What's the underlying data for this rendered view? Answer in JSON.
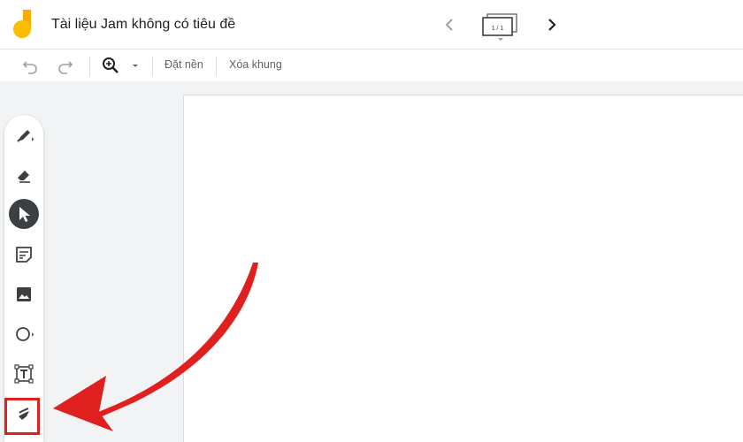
{
  "header": {
    "title": "Tài liệu Jam không có tiêu đề",
    "frame_counter": "1 / 1"
  },
  "toolbar": {
    "undo_icon": "undo-icon",
    "redo_icon": "redo-icon",
    "zoom_icon": "zoom-in-icon",
    "set_background_label": "Đặt nền",
    "clear_frame_label": "Xóa khung"
  },
  "tools": [
    {
      "name": "pen-tool",
      "icon": "pen-icon"
    },
    {
      "name": "eraser-tool",
      "icon": "eraser-icon"
    },
    {
      "name": "select-tool",
      "icon": "cursor-arrow-icon",
      "selected": true
    },
    {
      "name": "sticky-note-tool",
      "icon": "sticky-note-icon"
    },
    {
      "name": "image-tool",
      "icon": "image-icon"
    },
    {
      "name": "shape-tool",
      "icon": "circle-icon"
    },
    {
      "name": "text-box-tool",
      "icon": "text-box-icon"
    },
    {
      "name": "laser-tool",
      "icon": "laser-icon",
      "highlighted": true
    }
  ],
  "colors": {
    "annotation": "#e01f1f",
    "logo_yellow": "#f9ab00",
    "selected_tool_bg": "#3c4043",
    "canvas_bg": "#f1f3f4"
  }
}
